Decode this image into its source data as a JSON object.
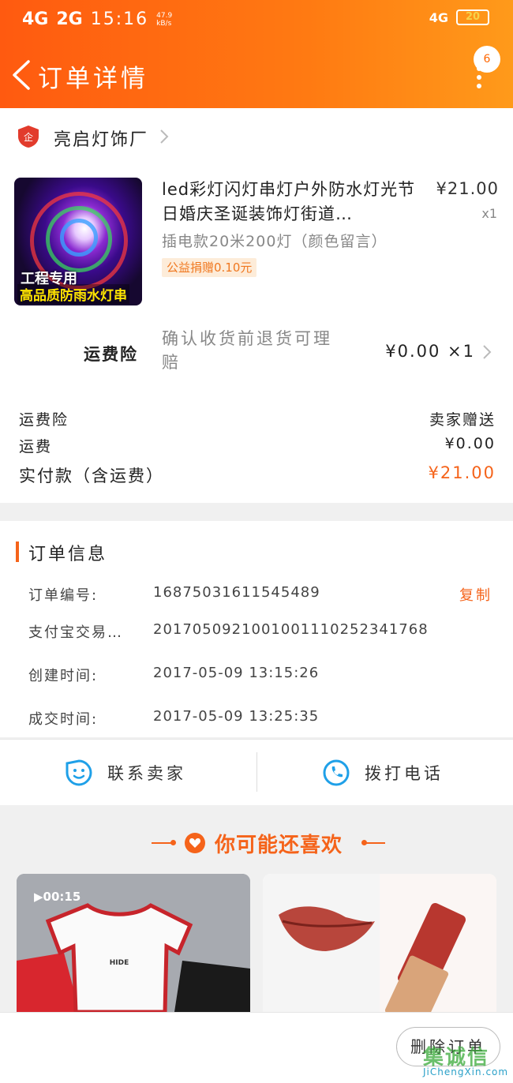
{
  "status_bar": {
    "signal1": "4G",
    "signal2": "2G",
    "time": "15:16",
    "net_speed": "47.9 kB/s",
    "signal3": "4G",
    "battery": "20"
  },
  "nav": {
    "title": "订单详情",
    "badge": "6"
  },
  "shop": {
    "badge_text": "企",
    "name": "亮启灯饰厂"
  },
  "product": {
    "title": "led彩灯闪灯串灯户外防水灯光节日婚庆圣诞装饰灯街道…",
    "price": "¥21.00",
    "qty": "x1",
    "sku": "插电款20米200灯（颜色留言）",
    "donate_tag": "公益捐赠0.10元",
    "thumb_caption1": "工程专用",
    "thumb_caption2": "高品质防雨水灯串"
  },
  "insurance": {
    "label": "运费险",
    "desc": "确认收货前退货可理赔",
    "price": "¥0.00 ×1"
  },
  "summary": {
    "rows": [
      {
        "label": "运费险",
        "value": "卖家赠送"
      },
      {
        "label": "运费",
        "value": "¥0.00"
      },
      {
        "label": "实付款（含运费）",
        "value": "¥21.00"
      }
    ]
  },
  "order_info": {
    "title": "订单信息",
    "copy_label": "复制",
    "rows": [
      {
        "label": "订单编号:",
        "value": "16875031611545489"
      },
      {
        "label": "支付宝交易…",
        "value": "2017050921001001110252341768"
      },
      {
        "label": "创建时间:",
        "value": "2017-05-09 13:15:26"
      },
      {
        "label": "成交时间:",
        "value": "2017-05-09 13:25:35"
      }
    ]
  },
  "actions": {
    "contact_seller": "联系卖家",
    "call_phone": "拨打电话"
  },
  "recommend": {
    "title": "你可能还喜欢",
    "video_duration": "00:15"
  },
  "bottom": {
    "delete_order": "删除订单",
    "watermark_cn": "集诚信",
    "watermark_en": "JiChengXin.com"
  },
  "colors": {
    "accent": "#f5631a",
    "header_start": "#ff5a10",
    "header_end": "#ff9a1a"
  }
}
